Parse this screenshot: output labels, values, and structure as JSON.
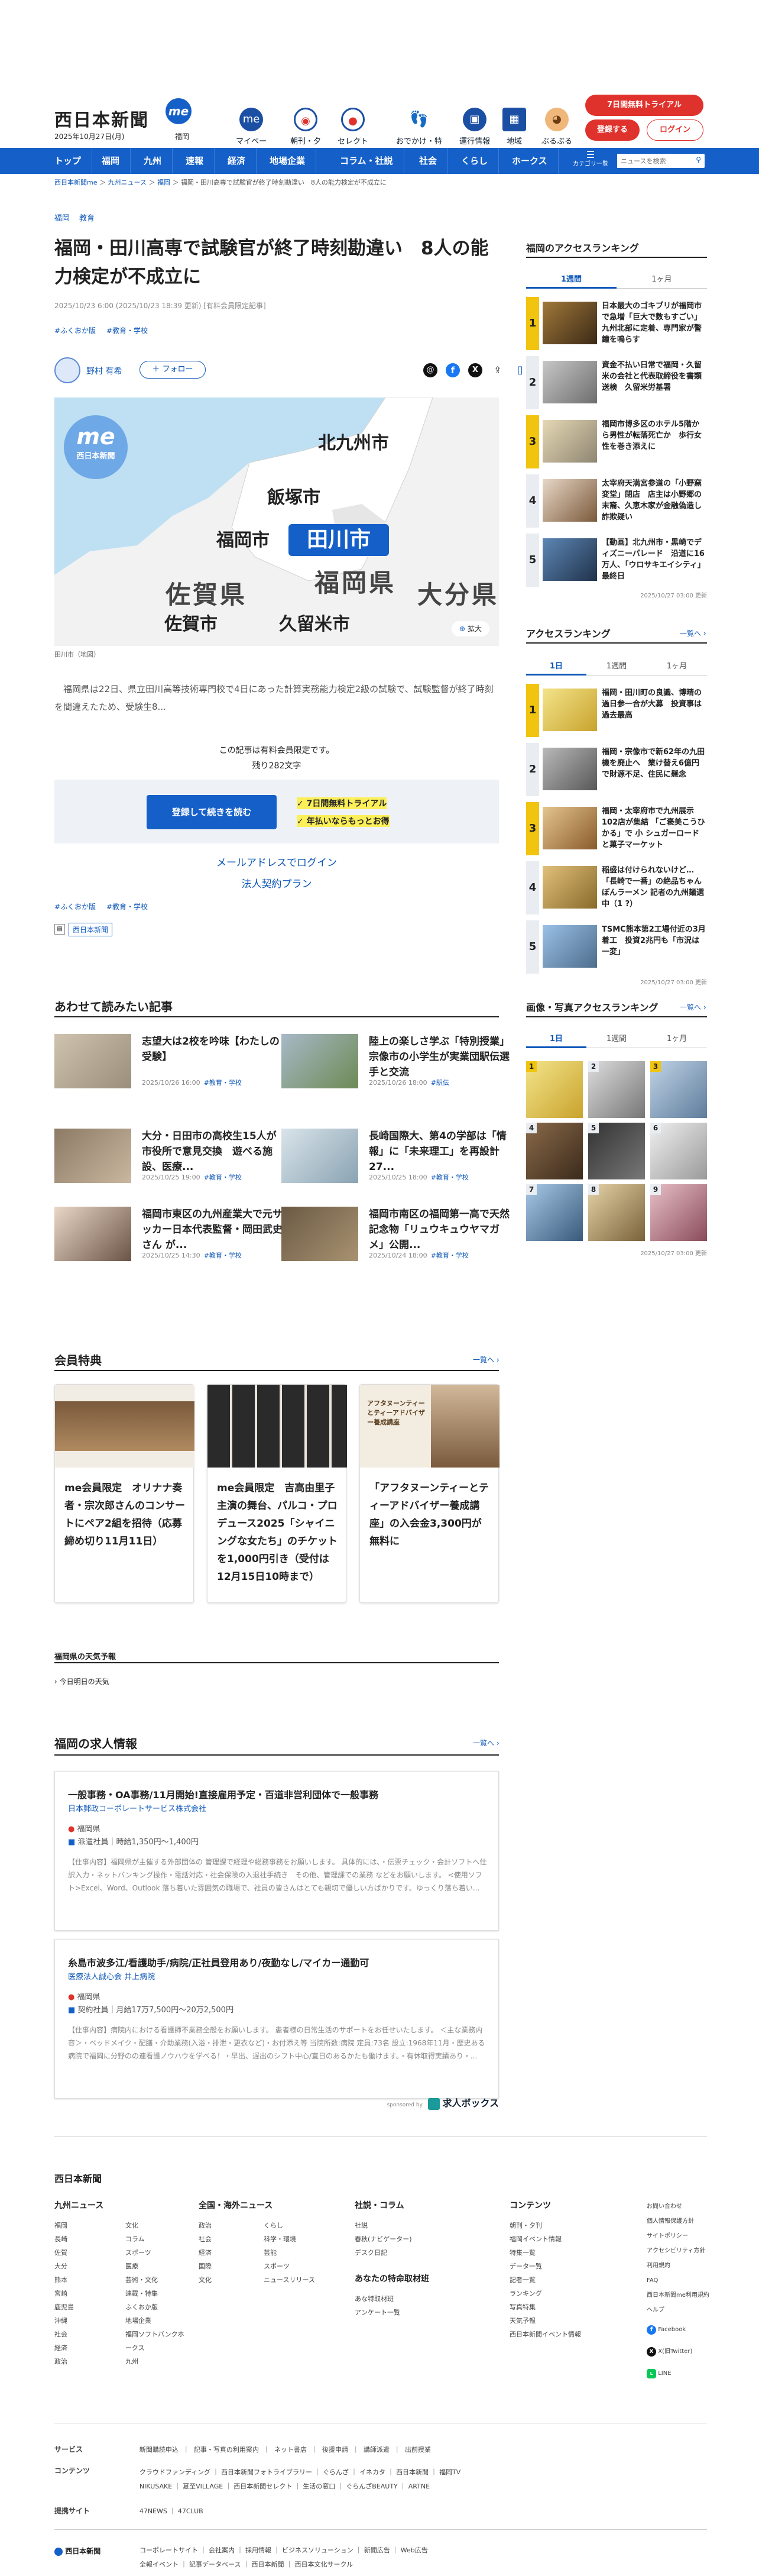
{
  "header": {
    "logo": "西日本新聞",
    "logo_sub": "me",
    "date": "2025年10月27日(月)",
    "region": "福岡",
    "icons": [
      {
        "name": "mypage-icon",
        "label": "マイページ"
      },
      {
        "name": "newspaper-icon",
        "label": "朝刊・夕刊"
      },
      {
        "name": "select-icon",
        "label": "セレクト"
      },
      {
        "name": "shoes-icon",
        "label": "おでかけ・特典"
      },
      {
        "name": "train-icon",
        "label": "運行情報"
      },
      {
        "name": "region-icon",
        "label": "地域"
      },
      {
        "name": "mascot-icon",
        "label": "ぶるぶる"
      },
      {
        "name": "me-icon",
        "label": "me"
      }
    ],
    "trial": "7日間無料トライアル",
    "register": "登録する",
    "login": "ログイン"
  },
  "nav": {
    "items": [
      "トップ",
      "福岡",
      "九州",
      "速報",
      "経済",
      "地場企業",
      "コラム・社説",
      "社会",
      "くらし",
      "ホークス",
      "カテゴリ一覧"
    ],
    "search_placeholder": "ニュースを検索"
  },
  "breadcrumb": [
    "西日本新聞me",
    "九州ニュース",
    "福岡",
    "福岡・田川高専で試験官が終了時刻勘違い　8人の能力検定が不成立に"
  ],
  "article": {
    "categories": [
      "福岡",
      "教育"
    ],
    "title": "福岡・田川高専で試験官が終了時刻勘違い　8人の能力検定が不成立に",
    "timestamp": "2025/10/23 6:00 (2025/10/23 18:39 更新) [有料会員限定記事]",
    "tags": [
      "#ふくおか版",
      "#教育・学校"
    ],
    "author": "野村 有希",
    "follow": "＋ フォロー",
    "map": {
      "brand": "西日本新聞",
      "places": [
        "北九州市",
        "飯塚市",
        "福岡市",
        "田川市",
        "福岡県",
        "佐賀県",
        "大分県",
        "佐賀市",
        "久留米市"
      ],
      "enlarge": "拡大",
      "caption": "田川市（地図）"
    },
    "lead": "福岡県は22日、県立田川高等技術専門校で4日にあった計算実務能力検定2級の試験で、試験監督が終了時刻を間違えたため、受験生8...",
    "paywall": {
      "note": "この記事は有料会員限定です。",
      "remaining": "残り282文字",
      "button": "登録して続きを読む",
      "points": [
        "7日間無料トライアル",
        "年払いならもっとお得"
      ],
      "email_login": "メールアドレスでログイン",
      "corp": "法人契約プラン"
    },
    "tags2": [
      "#ふくおか版",
      "#教育・学校"
    ],
    "paper": "西日本新聞"
  },
  "related": {
    "title": "あわせて読みたい記事",
    "items": [
      {
        "title": "志望大は2校を吟味【わたしの受験】",
        "date": "2025/10/26 16:00",
        "tag": "#教育・学校"
      },
      {
        "title": "陸上の楽しさ学ぶ「特別授業」 宗像市の小学生が実業団駅伝選手と交流",
        "date": "2025/10/26 18:00",
        "tag": "#駅伝"
      },
      {
        "title": "大分・日田市の高校生15人が市役所で意見交換　遊べる施設、医療...",
        "date": "2025/10/25 19:00",
        "tag": "#教育・学校"
      },
      {
        "title": "長崎国際大、第4の学部は「情報」に「未来理工」を再設計　27...",
        "date": "2025/10/25 18:00",
        "tag": "#教育・学校"
      },
      {
        "title": "福岡市東区の九州産業大で元サッカー日本代表監督・岡田武史さん が...",
        "date": "2025/10/25 14:30",
        "tag": "#教育・学校"
      },
      {
        "title": "福岡市南区の福岡第一高で天然記念物「リュウキュウヤマガメ」公開...",
        "date": "2025/10/24 18:00",
        "tag": "#教育・学校"
      }
    ]
  },
  "perks": {
    "title": "会員特典",
    "more": "一覧へ",
    "items": [
      "me会員限定　オリナナ奏者・宗次郎さんのコンサートにペア2組を招待（応募締め切り11月11日）",
      "me会員限定　吉高由里子主演の舞台、パルコ・プロデュース2025「シャイニングな女たち」のチケットを1,000円引き（受付は12月15日10時まで）",
      "「アフタヌーンティーとティーアドバイザー養成講座」の入会金3,300円が無料に"
    ],
    "poster_caption": "アフタヌーンティーとティーアドバイザー養成講座"
  },
  "weather": {
    "title": "福岡県の天気予報",
    "link": "今日明日の天気"
  },
  "jobs": {
    "title": "福岡の求人情報",
    "more": "一覧へ",
    "items": [
      {
        "title": "一般事務・OA事務/11月開始!直接雇用予定・百道非営利団体で一般事務",
        "company": "日本郵政コーポレートサービス株式会社",
        "location": "福岡県",
        "wage": "派遣社員｜時給1,350円〜1,400円",
        "desc": "【仕事内容】福岡県が主催する外部団体の 管理課で経理や総務事務をお願いします。 具体的には、・伝票チェック・会計ソフトへ仕訳入力・ネットバンキング操作・電話対応・社会保険の入退社手続き　その他、管理課での業務 などをお願いします。 <使用ソフト>Excel、Word、Outlook 落ち着いた雰囲気の職場で、社員の皆さんはとても親切で優しい方ばかりです。ゆっくり落ち着い..."
      },
      {
        "title": "糸島市波多江/看護助手/病院/正社員登用あり/夜勤なし/マイカー通勤可",
        "company": "医療法人誠心会 井上病院",
        "location": "福岡県",
        "wage": "契約社員｜月給17万7,500円〜20万2,500円",
        "desc": "【仕事内容】病院内における看護師不業務全般をお願いします。 患者様の日常生活のサポートをお任せいたします。 ＜主な業務内容＞・ベッドメイク・配膳・介助業務(入浴・排泄・更衣など)・お付添え等 当院所数:病院 定員:73名 設立:1968年11月・歴史ある病院で福岡に分野のの連看護ノウハウを学べる！・早出、遅出のシフト中心/直日のあるかたも働けます。・有休取得実績あり・..."
      }
    ],
    "sponsor": "sponsored by",
    "sponsor_brand": "求人ボックス"
  },
  "sidebar": {
    "access_title": "福岡のアクセスランキング",
    "tabs1": [
      "1週間",
      "1ヶ月"
    ],
    "ranks1": [
      "日本最大のゴキブリが福岡市で急増「巨大で数もすごい」 九州北部に定着、専門家が警鐘を鳴らす",
      "資金不払い日常で福岡・久留米の会社と代表取締役を書類送検　久留米労基署",
      "福岡市博多区のホテル5階から男性が転落死亡か　歩行女性を巻き添えに",
      "太宰府天満宮参道の「小野窯変堂」閉店　店主は小野郷の末裔、久恵木家が金融偽造し詐欺疑い",
      "【動画】北九州市・黒崎でディズニーパレード　沿道に16万人、「ウロサキエイシティ」最終日"
    ],
    "updated1": "2025/10/27 03:00 更新",
    "rank_title": "アクセスランキング",
    "more": "一覧へ",
    "tabs2": [
      "1日",
      "1週間",
      "1ヶ月"
    ],
    "ranks2": [
      "福岡・田川町の良識、博晴の過日参一合が大募　投資事は過去最高",
      "福岡・宗像市で新62年の九田機を廃止へ　業け替え6億円で財源不足、住民に懸念",
      "福岡・太宰府市で九州展示102店が集結 「ご褒美こうひかる」で 小 シュガーロードと菓子マーケット",
      "稲盛は付けられないけど…「長崎で一番」の絶品ちゃんぽんラーメン 記者の九州麺選中（1 ?）",
      "TSMC熊本第2工場付近の3月着工　投資2兆円も「市況は一変」"
    ],
    "updated2": "2025/10/27 03:00 更新",
    "photo_title": "画像・写真アクセスランキング",
    "photo_tabs": [
      "1日",
      "1週間",
      "1ヶ月"
    ],
    "photo_ranks": [
      "1",
      "2",
      "3",
      "4",
      "5",
      "6",
      "7",
      "8",
      "9"
    ],
    "updated3": "2025/10/27 03:00 更新"
  },
  "footer": {
    "logo": "西日本新聞",
    "cols": [
      {
        "title": "九州ニュース",
        "items": [
          "福岡",
          "長崎",
          "佐賀",
          "大分",
          "熊本",
          "宮崎",
          "鹿児島",
          "沖縄",
          "社会",
          "経済",
          "政治",
          "文化",
          "コラム",
          "スポーツ",
          "医療",
          "芸術・文化",
          "連載・特集",
          "ふくおか版",
          "地場企業",
          "福岡ソフトバンクホークス",
          "九州"
        ]
      },
      {
        "title": "全国・海外ニュース",
        "items": [
          "政治",
          "社会",
          "経済",
          "国際",
          "文化",
          "くらし",
          "科学・環境",
          "芸能",
          "スポーツ",
          "ニュースリリース"
        ]
      },
      {
        "title": "社説・コラム",
        "items": [
          "社説",
          "春秋(ナビゲーター)",
          "デスク日記"
        ]
      },
      {
        "title": "あなたの特命取材班",
        "items": [
          "あな特取材班",
          "アンケート一覧"
        ]
      },
      {
        "title": "コンテンツ",
        "items": [
          "朝刊・夕刊",
          "福岡イベント情報",
          "特集一覧",
          "データ一覧",
          "記者一覧",
          "ランキング",
          "写真特集",
          "天気予報",
          "西日本新聞イベント情報"
        ]
      },
      {
        "title": "",
        "items": [
          "お問い合わせ",
          "個人情報保護方針",
          "サイトポリシー",
          "アクセシビリティ方針",
          "利用規約",
          "FAQ",
          "西日本新聞me利用規約",
          "ヘルプ",
          "Facebook",
          "X(旧Twitter)",
          "LINE"
        ]
      }
    ],
    "rows": [
      {
        "label": "サービス",
        "items": [
          "新聞購読申込",
          "記事・写真の利用案内",
          "ネット書店",
          "後援申請",
          "講師派遣",
          "出前授業"
        ]
      },
      {
        "label": "コンテンツ",
        "items": [
          "クラウドファンディング",
          "西日本新聞フォトライブラリー",
          "ぐらんざ",
          "イネカタ",
          "西日本新聞",
          "福岡TV",
          "NIKUSAKE",
          "夏至VILLAGE",
          "西日本新聞セレクト",
          "生活の窓口",
          "ぐらんざBEAUTY",
          "ARTNE"
        ]
      },
      {
        "label": "提携サイト",
        "items": [
          "47NEWS",
          "47CLUB"
        ]
      }
    ],
    "corp": [
      "コーポレートサイト",
      "会社案内",
      "採用情報",
      "ビジネスソリューション",
      "新聞広告",
      "Web広告",
      "全報イベント",
      "記事データベース",
      "西日本新聞",
      "西日本文化サークル"
    ],
    "copyright": "西日本新聞"
  },
  "colors": {
    "accent": "#1560c8",
    "brand": "#0d57b8",
    "red": "#e0322c",
    "yellow": "#f1c40f"
  }
}
